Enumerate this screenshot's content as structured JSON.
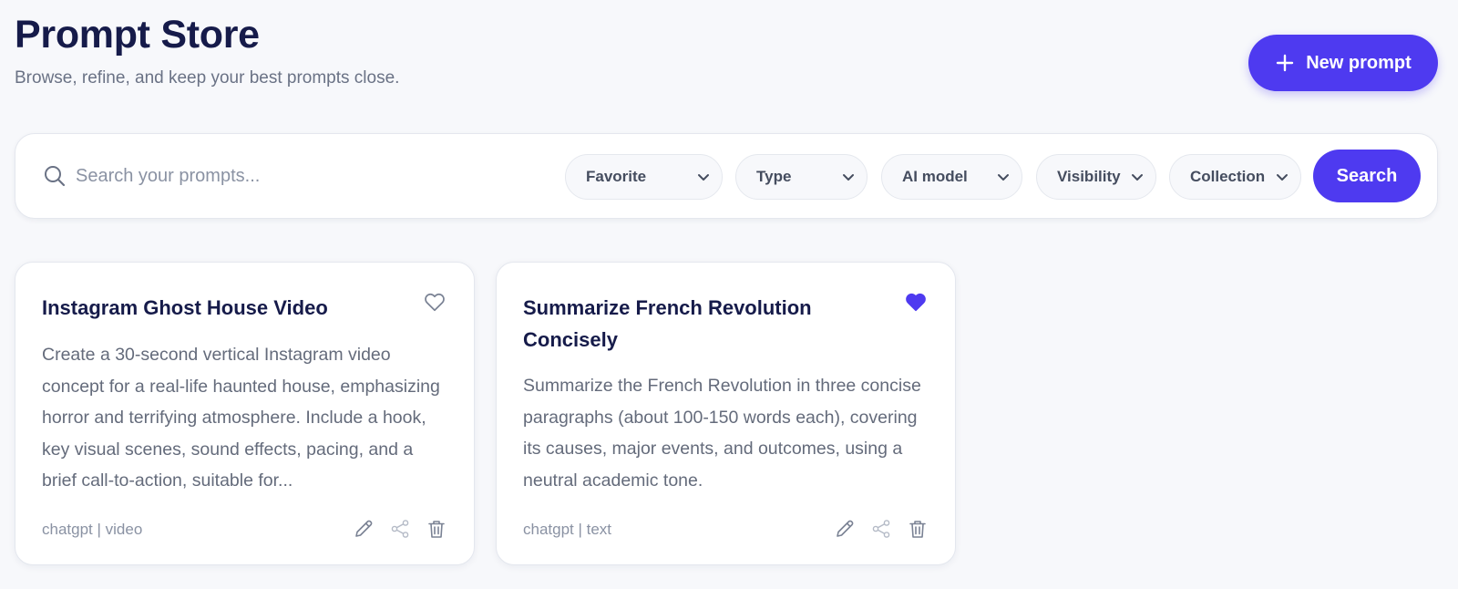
{
  "header": {
    "title": "Prompt Store",
    "subtitle": "Browse, refine, and keep your best prompts close.",
    "new_prompt_label": "New prompt"
  },
  "search": {
    "placeholder": "Search your prompts...",
    "value": "",
    "button_label": "Search"
  },
  "filters": [
    {
      "label": "Favorite"
    },
    {
      "label": "Type"
    },
    {
      "label": "AI model"
    },
    {
      "label": "Visibility"
    },
    {
      "label": "Collection"
    }
  ],
  "cards": [
    {
      "title": "Instagram Ghost House Video",
      "description": "Create a 30-second vertical Instagram video concept for a real-life haunted house, emphasizing horror and terrifying atmosphere. Include a hook, key visual scenes, sound effects, pacing, and a brief call-to-action, suitable for...",
      "meta": "chatgpt | video",
      "favorite": false
    },
    {
      "title": "Summarize French Revolution Concisely",
      "description": "Summarize the French Revolution in three concise paragraphs (about 100-150 words each), covering its causes, major events, and outcomes, using a neutral academic tone.",
      "meta": "chatgpt | text",
      "favorite": true
    }
  ],
  "icons": {
    "new_prompt": "plus-icon",
    "search": "search-icon",
    "filter_chevron": "chevron-down-icon",
    "favorite_off": "heart-outline-icon",
    "favorite_on": "heart-filled-icon",
    "edit": "pencil-icon",
    "share": "share-icon",
    "delete": "trash-icon"
  },
  "colors": {
    "accent": "#4e3af0",
    "title": "#161b4a",
    "muted": "#8a92a3",
    "background": "#f7f8fb"
  }
}
